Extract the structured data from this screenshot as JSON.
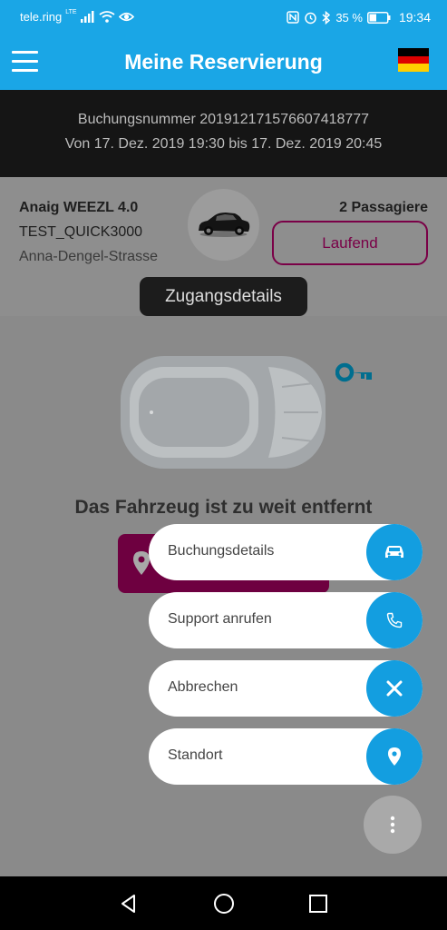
{
  "status_bar": {
    "carrier": "tele.ring",
    "network_type": "LTE",
    "battery": "35 %",
    "time": "19:34"
  },
  "header": {
    "title": "Meine Reservierung",
    "menu_icon": "hamburger-menu-icon",
    "flag_icon": "german-flag-icon",
    "flag_colors": [
      "#000000",
      "#dd0000",
      "#ffce00"
    ],
    "accent_color": "#1aa6e6"
  },
  "booking": {
    "number_line": "Buchungsnummer 201912171576607418777",
    "period_line": "Von 17. Dez. 2019 19:30 bis 17. Dez. 2019 20:45"
  },
  "vehicle": {
    "name": "Anaig WEEZL 4.0",
    "plate": "TEST_QUICK3000",
    "street": "Anna-Dengel-Strasse",
    "passengers": "2 Passagiere",
    "status": "Laufend",
    "status_color": "#7a0047",
    "thumbnail_icon": "car-icon"
  },
  "tooltip": "Zugangsdetails",
  "main": {
    "distance_message": "Das Fahrzeug ist zu weit entfernt",
    "car_icon": "car-topview-icon",
    "key_icon": "key-icon",
    "locate_icon": "location-pin-icon"
  },
  "fab_menu": {
    "items": [
      {
        "label": "Buchungsdetails",
        "icon": "car-icon"
      },
      {
        "label": "Support anrufen",
        "icon": "phone-icon"
      },
      {
        "label": "Abbrechen",
        "icon": "close-icon"
      },
      {
        "label": "Standort",
        "icon": "location-pin-icon"
      }
    ],
    "toggle_icon": "more-vertical-icon"
  },
  "nav_bar": {
    "back_icon": "back-triangle-icon",
    "home_icon": "home-circle-icon",
    "recents_icon": "recents-square-icon"
  }
}
